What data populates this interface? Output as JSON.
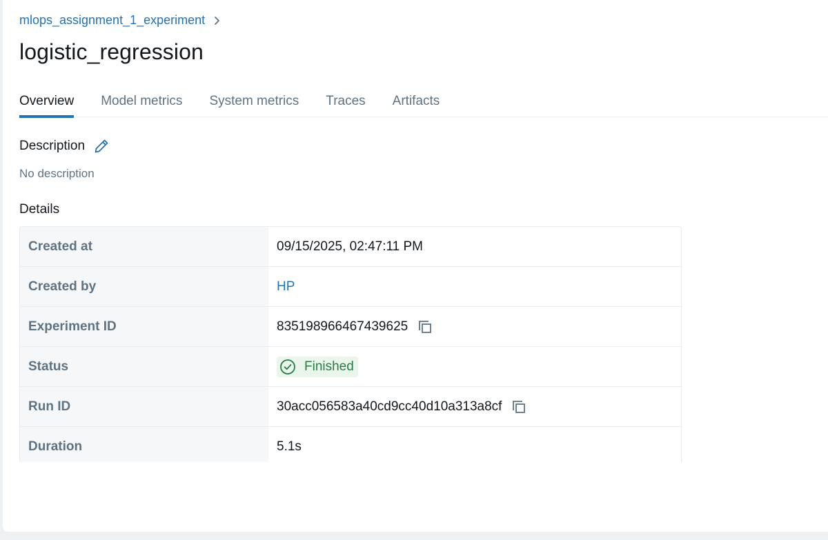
{
  "breadcrumb": {
    "experiment": "mlops_assignment_1_experiment",
    "separator_icon": "chevron-right-icon"
  },
  "page": {
    "title": "logistic_regression"
  },
  "tabs": [
    {
      "label": "Overview",
      "active": true
    },
    {
      "label": "Model metrics",
      "active": false
    },
    {
      "label": "System metrics",
      "active": false
    },
    {
      "label": "Traces",
      "active": false
    },
    {
      "label": "Artifacts",
      "active": false
    }
  ],
  "description": {
    "heading": "Description",
    "edit_icon": "pencil-icon",
    "empty_text": "No description"
  },
  "details": {
    "heading": "Details",
    "rows": [
      {
        "key": "Created at",
        "value": "09/15/2025, 02:47:11 PM"
      },
      {
        "key": "Created by",
        "value": "HP"
      },
      {
        "key": "Experiment ID",
        "value": "835198966467439625"
      },
      {
        "key": "Status",
        "value": "Finished"
      },
      {
        "key": "Run ID",
        "value": "30acc056583a40cd9cc40d10a313a8cf"
      },
      {
        "key": "Duration",
        "value": "5.1s"
      }
    ]
  },
  "colors": {
    "accent": "#2272b4",
    "muted_text": "#5f7281",
    "success_text": "#277c43",
    "success_bg": "#eaf6ec"
  }
}
